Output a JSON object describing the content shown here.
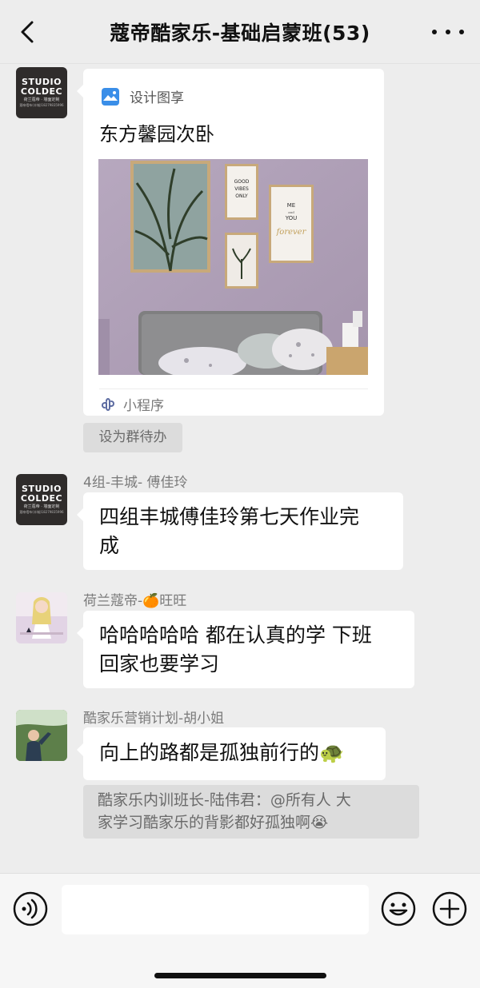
{
  "header": {
    "title": "蔻帝酷家乐-基础启蒙班(53)"
  },
  "mini_program_card": {
    "app_name": "设计图享",
    "title": "东方馨园次卧",
    "footer_label": "小程序",
    "art": {
      "sign1": [
        "GOOD",
        "VIBES",
        "ONLY"
      ],
      "sign2": [
        "ME",
        "and",
        "YOU"
      ],
      "sign2_script": "forever"
    }
  },
  "studio_avatar": {
    "line1": "STUDIO",
    "line2": "COLDEC",
    "line3": "荷兰蔻帝 · 墙面定制",
    "line4": "蔻帝墙布(丰城)18279835996"
  },
  "set_todo_label": "设为群待办",
  "messages": [
    {
      "sender": "4组-丰城- 傅佳玲",
      "lines": [
        "四组丰城傅佳玲第七天作业完",
        "成"
      ]
    },
    {
      "sender": "荷兰蔻帝-🍊旺旺",
      "lines": [
        "哈哈哈哈哈 都在认真的学 下班",
        "回家也要学习"
      ]
    },
    {
      "sender": "酷家乐营销计划-胡小姐",
      "lines": [
        "向上的路都是孤独前行的🐢"
      ]
    }
  ],
  "quote": {
    "lines": [
      "酷家乐内训班长-陆伟君：@所有人 大",
      "家学习酷家乐的背影都好孤独啊😭"
    ]
  },
  "input": {
    "placeholder": ""
  }
}
